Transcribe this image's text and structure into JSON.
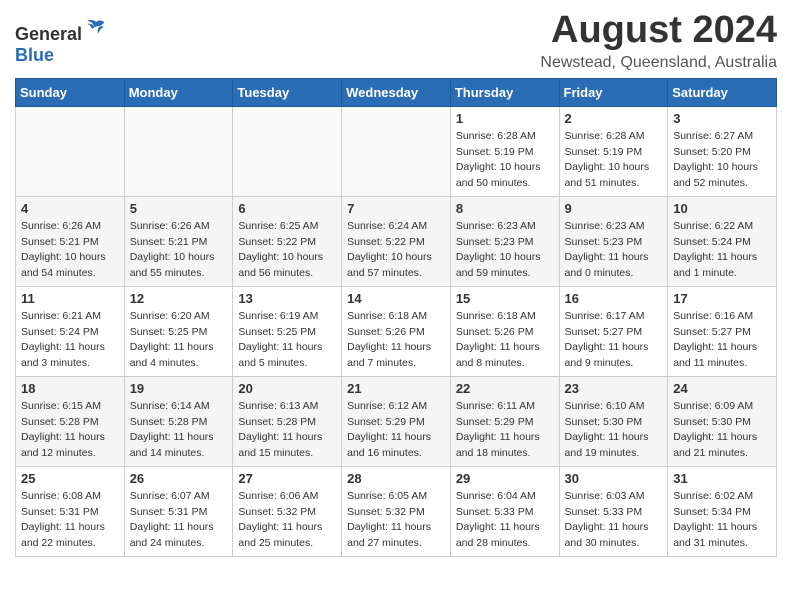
{
  "header": {
    "logo_general": "General",
    "logo_blue": "Blue",
    "month_title": "August 2024",
    "location": "Newstead, Queensland, Australia"
  },
  "days_of_week": [
    "Sunday",
    "Monday",
    "Tuesday",
    "Wednesday",
    "Thursday",
    "Friday",
    "Saturday"
  ],
  "weeks": [
    [
      {
        "day": "",
        "info": ""
      },
      {
        "day": "",
        "info": ""
      },
      {
        "day": "",
        "info": ""
      },
      {
        "day": "",
        "info": ""
      },
      {
        "day": "1",
        "info": "Sunrise: 6:28 AM\nSunset: 5:19 PM\nDaylight: 10 hours\nand 50 minutes."
      },
      {
        "day": "2",
        "info": "Sunrise: 6:28 AM\nSunset: 5:19 PM\nDaylight: 10 hours\nand 51 minutes."
      },
      {
        "day": "3",
        "info": "Sunrise: 6:27 AM\nSunset: 5:20 PM\nDaylight: 10 hours\nand 52 minutes."
      }
    ],
    [
      {
        "day": "4",
        "info": "Sunrise: 6:26 AM\nSunset: 5:21 PM\nDaylight: 10 hours\nand 54 minutes."
      },
      {
        "day": "5",
        "info": "Sunrise: 6:26 AM\nSunset: 5:21 PM\nDaylight: 10 hours\nand 55 minutes."
      },
      {
        "day": "6",
        "info": "Sunrise: 6:25 AM\nSunset: 5:22 PM\nDaylight: 10 hours\nand 56 minutes."
      },
      {
        "day": "7",
        "info": "Sunrise: 6:24 AM\nSunset: 5:22 PM\nDaylight: 10 hours\nand 57 minutes."
      },
      {
        "day": "8",
        "info": "Sunrise: 6:23 AM\nSunset: 5:23 PM\nDaylight: 10 hours\nand 59 minutes."
      },
      {
        "day": "9",
        "info": "Sunrise: 6:23 AM\nSunset: 5:23 PM\nDaylight: 11 hours\nand 0 minutes."
      },
      {
        "day": "10",
        "info": "Sunrise: 6:22 AM\nSunset: 5:24 PM\nDaylight: 11 hours\nand 1 minute."
      }
    ],
    [
      {
        "day": "11",
        "info": "Sunrise: 6:21 AM\nSunset: 5:24 PM\nDaylight: 11 hours\nand 3 minutes."
      },
      {
        "day": "12",
        "info": "Sunrise: 6:20 AM\nSunset: 5:25 PM\nDaylight: 11 hours\nand 4 minutes."
      },
      {
        "day": "13",
        "info": "Sunrise: 6:19 AM\nSunset: 5:25 PM\nDaylight: 11 hours\nand 5 minutes."
      },
      {
        "day": "14",
        "info": "Sunrise: 6:18 AM\nSunset: 5:26 PM\nDaylight: 11 hours\nand 7 minutes."
      },
      {
        "day": "15",
        "info": "Sunrise: 6:18 AM\nSunset: 5:26 PM\nDaylight: 11 hours\nand 8 minutes."
      },
      {
        "day": "16",
        "info": "Sunrise: 6:17 AM\nSunset: 5:27 PM\nDaylight: 11 hours\nand 9 minutes."
      },
      {
        "day": "17",
        "info": "Sunrise: 6:16 AM\nSunset: 5:27 PM\nDaylight: 11 hours\nand 11 minutes."
      }
    ],
    [
      {
        "day": "18",
        "info": "Sunrise: 6:15 AM\nSunset: 5:28 PM\nDaylight: 11 hours\nand 12 minutes."
      },
      {
        "day": "19",
        "info": "Sunrise: 6:14 AM\nSunset: 5:28 PM\nDaylight: 11 hours\nand 14 minutes."
      },
      {
        "day": "20",
        "info": "Sunrise: 6:13 AM\nSunset: 5:28 PM\nDaylight: 11 hours\nand 15 minutes."
      },
      {
        "day": "21",
        "info": "Sunrise: 6:12 AM\nSunset: 5:29 PM\nDaylight: 11 hours\nand 16 minutes."
      },
      {
        "day": "22",
        "info": "Sunrise: 6:11 AM\nSunset: 5:29 PM\nDaylight: 11 hours\nand 18 minutes."
      },
      {
        "day": "23",
        "info": "Sunrise: 6:10 AM\nSunset: 5:30 PM\nDaylight: 11 hours\nand 19 minutes."
      },
      {
        "day": "24",
        "info": "Sunrise: 6:09 AM\nSunset: 5:30 PM\nDaylight: 11 hours\nand 21 minutes."
      }
    ],
    [
      {
        "day": "25",
        "info": "Sunrise: 6:08 AM\nSunset: 5:31 PM\nDaylight: 11 hours\nand 22 minutes."
      },
      {
        "day": "26",
        "info": "Sunrise: 6:07 AM\nSunset: 5:31 PM\nDaylight: 11 hours\nand 24 minutes."
      },
      {
        "day": "27",
        "info": "Sunrise: 6:06 AM\nSunset: 5:32 PM\nDaylight: 11 hours\nand 25 minutes."
      },
      {
        "day": "28",
        "info": "Sunrise: 6:05 AM\nSunset: 5:32 PM\nDaylight: 11 hours\nand 27 minutes."
      },
      {
        "day": "29",
        "info": "Sunrise: 6:04 AM\nSunset: 5:33 PM\nDaylight: 11 hours\nand 28 minutes."
      },
      {
        "day": "30",
        "info": "Sunrise: 6:03 AM\nSunset: 5:33 PM\nDaylight: 11 hours\nand 30 minutes."
      },
      {
        "day": "31",
        "info": "Sunrise: 6:02 AM\nSunset: 5:34 PM\nDaylight: 11 hours\nand 31 minutes."
      }
    ]
  ]
}
